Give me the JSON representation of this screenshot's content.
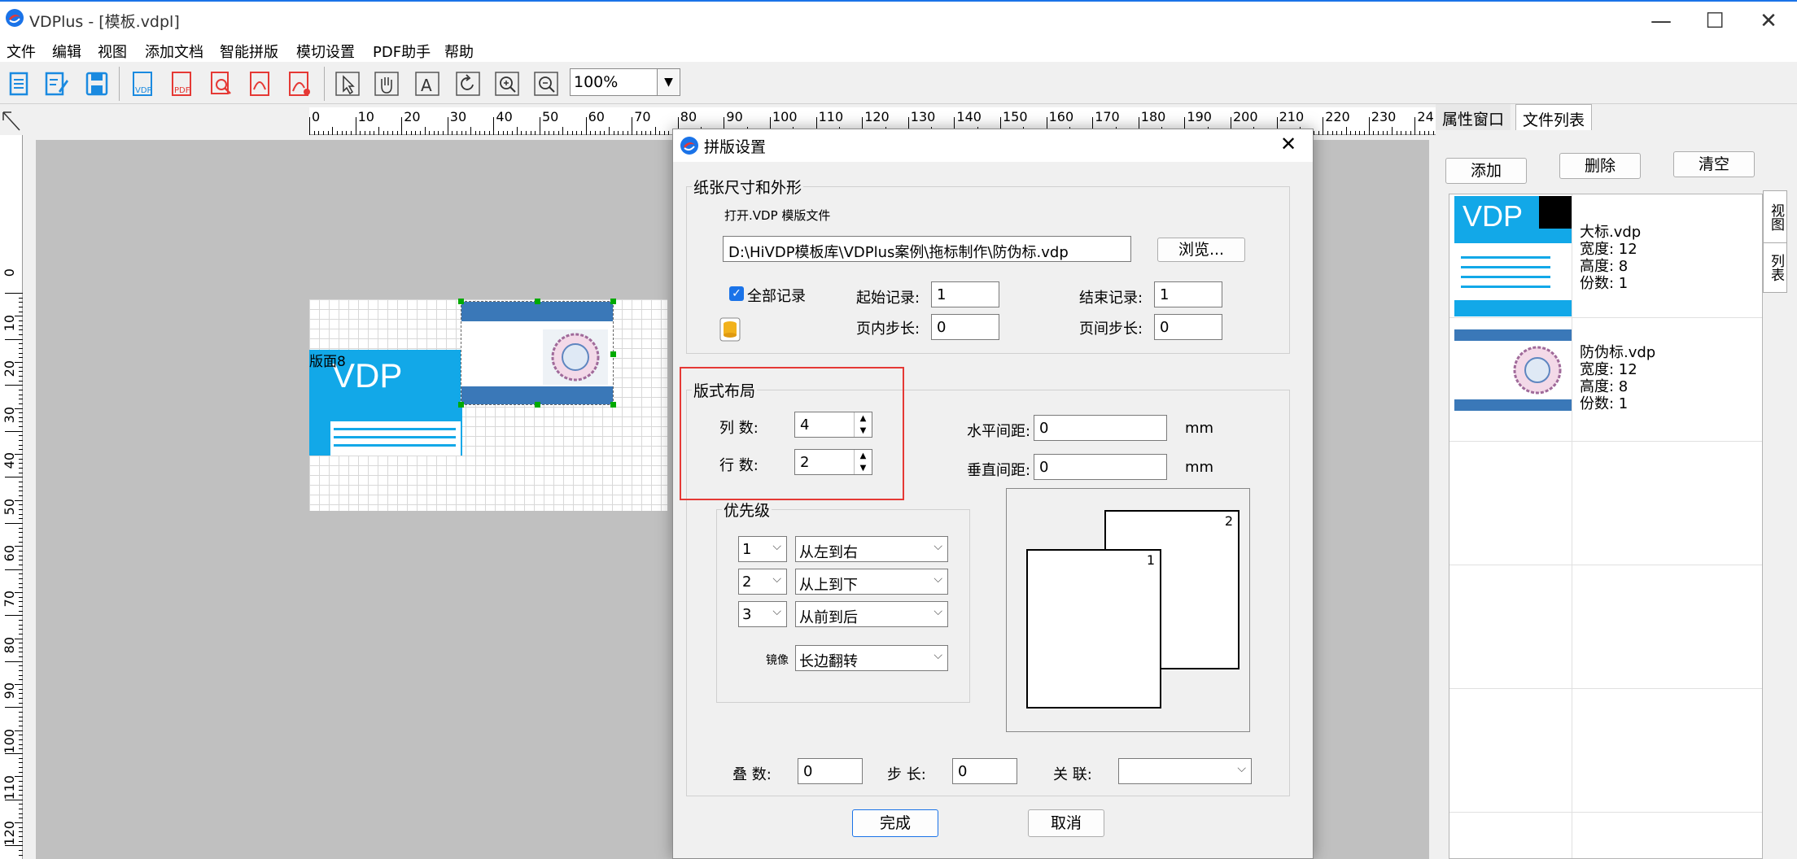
{
  "window": {
    "title": "VDPlus - [模板.vdpl]"
  },
  "menu": [
    "文件",
    "编辑",
    "视图",
    "添加文档",
    "智能拼版",
    "模切设置",
    "PDF助手",
    "帮助"
  ],
  "toolbar": {
    "zoom": "100%"
  },
  "ruler": {
    "h_labels": [
      "0",
      "10",
      "20",
      "30",
      "40",
      "50",
      "60",
      "70",
      "80",
      "90",
      "100",
      "110",
      "120",
      "130",
      "140",
      "150",
      "160",
      "170",
      "180",
      "190",
      "200",
      "210",
      "220",
      "230",
      "24"
    ],
    "v_labels": [
      "0",
      "10",
      "20",
      "30",
      "40",
      "50",
      "60",
      "70",
      "80",
      "90",
      "100",
      "110",
      "120"
    ]
  },
  "canvas": {
    "overlay_text": "版面8"
  },
  "right_panel": {
    "tabs": [
      "属性窗口",
      "文件列表"
    ],
    "buttons": {
      "add": "添加",
      "delete": "删除",
      "clear": "清空"
    },
    "side_tabs": [
      "视图",
      "列表"
    ],
    "files": [
      {
        "name": "大标.vdp",
        "width": "宽度: 12",
        "height": "高度: 8",
        "copies": "份数: 1"
      },
      {
        "name": "防伪标.vdp",
        "width": "宽度: 12",
        "height": "高度: 8",
        "copies": "份数: 1"
      }
    ]
  },
  "dialog": {
    "title": "拼版设置",
    "paper": {
      "group": "纸张尺寸和外形",
      "open_label": "打开.VDP 模版文件",
      "path": "D:\\HiVDP模板库\\VDPlus案例\\拖标制作\\防伪标.vdp",
      "browse": "浏览...",
      "all_records": "全部记录",
      "start_record_label": "起始记录:",
      "start_record": "1",
      "end_record_label": "结束记录:",
      "end_record": "1",
      "in_page_step_label": "页内步长:",
      "in_page_step": "0",
      "between_page_step_label": "页间步长:",
      "between_page_step": "0"
    },
    "layout": {
      "group": "版式布局",
      "cols_label": "列  数:",
      "cols": "4",
      "rows_label": "行  数:",
      "rows": "2",
      "h_gap_label": "水平间距:",
      "h_gap": "0",
      "v_gap_label": "垂直间距:",
      "v_gap": "0",
      "unit": "mm",
      "priority": {
        "group": "优先级",
        "items": [
          {
            "num": "1",
            "dir": "从左到右"
          },
          {
            "num": "2",
            "dir": "从上到下"
          },
          {
            "num": "3",
            "dir": "从前到后"
          }
        ],
        "mirror_label": "镜像",
        "mirror": "长边翻转"
      },
      "preview": {
        "sheet1": "1",
        "sheet2": "2"
      },
      "stack_label": "叠  数:",
      "stack": "0",
      "step_label": "步  长:",
      "step": "0",
      "link_label": "关  联:",
      "link": ""
    },
    "ok": "完成",
    "cancel": "取消"
  },
  "colors": {
    "accent": "#1a73e8",
    "vdp_blue": "#12a8e8",
    "highlight": "#e53935"
  }
}
